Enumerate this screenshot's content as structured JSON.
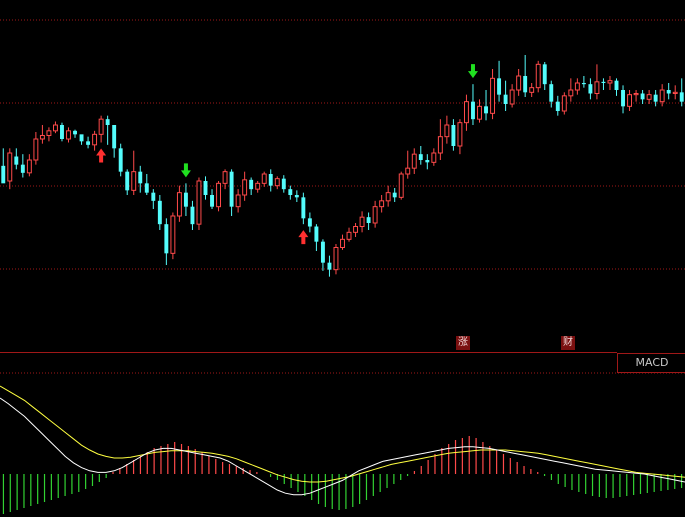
{
  "indicator_tab": {
    "label": "MACD"
  },
  "event_badges": [
    {
      "label": "涨"
    },
    {
      "label": "财"
    }
  ],
  "colors": {
    "up": "#ff4a4a",
    "down": "#54fcfc",
    "macd_positive": "#ff4a4a",
    "macd_negative": "#32d232",
    "dif_line": "#ffffff",
    "dea_line": "#ffff40",
    "grid": "#a01818",
    "buy_arrow": "#ff3030",
    "sell_arrow": "#20e020"
  },
  "chart_data": [
    {
      "type": "candlestick",
      "candles": [
        [
          175,
          160,
          165,
          190
        ],
        [
          162,
          186,
          155,
          190
        ],
        [
          183,
          176,
          172,
          190
        ],
        [
          176,
          169,
          165,
          185
        ],
        [
          169,
          180,
          166,
          185
        ],
        [
          180,
          198,
          176,
          204
        ],
        [
          198,
          201,
          194,
          210
        ],
        [
          201,
          205,
          196,
          208
        ],
        [
          205,
          210,
          203,
          213
        ],
        [
          210,
          198,
          196,
          212
        ],
        [
          198,
          205,
          195,
          208
        ],
        [
          205,
          202,
          199,
          206
        ],
        [
          202,
          196,
          193,
          198
        ],
        [
          196,
          193,
          190,
          200
        ],
        [
          193,
          202,
          188,
          205
        ],
        [
          202,
          215,
          195,
          218
        ],
        [
          215,
          210,
          193,
          218
        ],
        [
          210,
          190,
          182,
          200
        ],
        [
          190,
          170,
          166,
          194
        ],
        [
          170,
          154,
          150,
          172
        ],
        [
          154,
          170,
          150,
          188
        ],
        [
          170,
          160,
          152,
          175
        ],
        [
          160,
          152,
          150,
          168
        ],
        [
          152,
          145,
          138,
          155
        ],
        [
          145,
          125,
          120,
          150
        ],
        [
          125,
          100,
          90,
          130
        ],
        [
          100,
          132,
          95,
          135
        ],
        [
          132,
          152,
          127,
          158
        ],
        [
          152,
          140,
          132,
          160
        ],
        [
          140,
          125,
          120,
          145
        ],
        [
          125,
          162,
          120,
          165
        ],
        [
          162,
          150,
          146,
          166
        ],
        [
          150,
          140,
          138,
          155
        ],
        [
          140,
          160,
          136,
          162
        ],
        [
          160,
          170,
          155,
          172
        ],
        [
          170,
          140,
          132,
          172
        ],
        [
          140,
          150,
          135,
          155
        ],
        [
          150,
          163,
          145,
          170
        ],
        [
          163,
          155,
          150,
          165
        ],
        [
          155,
          160,
          152,
          162
        ],
        [
          160,
          168,
          157,
          170
        ],
        [
          168,
          158,
          153,
          172
        ],
        [
          158,
          164,
          155,
          166
        ],
        [
          164,
          155,
          152,
          167
        ],
        [
          155,
          150,
          146,
          158
        ],
        [
          150,
          148,
          144,
          154
        ],
        [
          148,
          130,
          125,
          152
        ],
        [
          130,
          123,
          118,
          135
        ],
        [
          123,
          110,
          102,
          125
        ],
        [
          110,
          92,
          85,
          112
        ],
        [
          92,
          86,
          80,
          98
        ],
        [
          86,
          105,
          82,
          108
        ],
        [
          105,
          112,
          103,
          116
        ],
        [
          112,
          118,
          110,
          122
        ],
        [
          118,
          123,
          114,
          126
        ],
        [
          123,
          131,
          118,
          136
        ],
        [
          131,
          126,
          120,
          135
        ],
        [
          126,
          140,
          122,
          145
        ],
        [
          140,
          145,
          135,
          150
        ],
        [
          145,
          152,
          140,
          158
        ],
        [
          152,
          148,
          144,
          156
        ],
        [
          148,
          168,
          146,
          170
        ],
        [
          168,
          173,
          164,
          188
        ],
        [
          173,
          185,
          168,
          190
        ],
        [
          185,
          180,
          176,
          192
        ],
        [
          180,
          178,
          172,
          185
        ],
        [
          178,
          186,
          175,
          190
        ],
        [
          186,
          200,
          180,
          215
        ],
        [
          200,
          210,
          194,
          218
        ],
        [
          210,
          192,
          188,
          215
        ],
        [
          192,
          212,
          185,
          215
        ],
        [
          212,
          230,
          205,
          236
        ],
        [
          230,
          215,
          210,
          245
        ],
        [
          215,
          226,
          212,
          232
        ],
        [
          226,
          220,
          214,
          240
        ],
        [
          220,
          250,
          215,
          258
        ],
        [
          250,
          236,
          230,
          265
        ],
        [
          236,
          228,
          222,
          248
        ],
        [
          228,
          240,
          225,
          245
        ],
        [
          240,
          252,
          235,
          258
        ],
        [
          252,
          238,
          234,
          270
        ],
        [
          238,
          242,
          234,
          246
        ],
        [
          242,
          262,
          238,
          265
        ],
        [
          262,
          245,
          240,
          264
        ],
        [
          245,
          230,
          225,
          248
        ],
        [
          230,
          222,
          218,
          235
        ],
        [
          222,
          235,
          219,
          238
        ],
        [
          235,
          240,
          230,
          250
        ],
        [
          240,
          246,
          236,
          250
        ],
        [
          246,
          245,
          242,
          252
        ],
        [
          245,
          237,
          232,
          250
        ],
        [
          237,
          247,
          232,
          262
        ],
        [
          247,
          246,
          240,
          250
        ],
        [
          246,
          248,
          240,
          252
        ],
        [
          248,
          240,
          235,
          250
        ],
        [
          240,
          226,
          220,
          244
        ],
        [
          226,
          236,
          222,
          240
        ],
        [
          236,
          237,
          230,
          240
        ],
        [
          237,
          232,
          228,
          240
        ],
        [
          232,
          236,
          228,
          240
        ],
        [
          236,
          230,
          226,
          240
        ],
        [
          230,
          240,
          226,
          245
        ],
        [
          240,
          237,
          232,
          246
        ],
        [
          237,
          238,
          232,
          244
        ],
        [
          238,
          230,
          226,
          250
        ]
      ],
      "signals": [
        {
          "type": "buy",
          "index": 15
        },
        {
          "type": "sell",
          "index": 28
        },
        {
          "type": "buy",
          "index": 46
        },
        {
          "type": "sell",
          "index": 72
        }
      ]
    },
    {
      "type": "macd",
      "histogram": [
        -40,
        -38,
        -36,
        -34,
        -32,
        -30,
        -28,
        -26,
        -24,
        -22,
        -20,
        -18,
        -15,
        -12,
        -8,
        -4,
        2,
        6,
        10,
        14,
        18,
        22,
        26,
        28,
        30,
        32,
        30,
        28,
        25,
        22,
        18,
        15,
        12,
        10,
        8,
        6,
        4,
        2,
        0,
        -3,
        -6,
        -10,
        -14,
        -18,
        -22,
        -26,
        -30,
        -33,
        -35,
        -36,
        -35,
        -33,
        -30,
        -26,
        -22,
        -18,
        -14,
        -10,
        -6,
        -2,
        3,
        8,
        14,
        20,
        26,
        30,
        34,
        36,
        38,
        36,
        32,
        28,
        24,
        20,
        16,
        12,
        8,
        5,
        2,
        -2,
        -6,
        -10,
        -13,
        -16,
        -18,
        -20,
        -22,
        -23,
        -24,
        -24,
        -23,
        -22,
        -21,
        -20,
        -19,
        -18,
        -17,
        -16,
        -15,
        -14
      ],
      "dif": [
        95,
        88,
        80,
        72,
        62,
        52,
        42,
        32,
        22,
        14,
        8,
        4,
        2,
        2,
        4,
        8,
        14,
        20,
        26,
        30,
        32,
        32,
        30,
        28,
        26,
        24,
        22,
        20,
        16,
        10,
        4,
        -2,
        -8,
        -14,
        -20,
        -24,
        -26,
        -26,
        -24,
        -20,
        -16,
        -12,
        -8,
        -2,
        4,
        8,
        12,
        16,
        18,
        20,
        22,
        24,
        26,
        28,
        30,
        32,
        33,
        34,
        34,
        33,
        32,
        30,
        28,
        26,
        24,
        22,
        20,
        18,
        16,
        14,
        12,
        10,
        8,
        6,
        5,
        4,
        3,
        2,
        1,
        0,
        -2,
        -4,
        -6,
        -8,
        -10
      ],
      "dea": [
        110,
        104,
        98,
        92,
        84,
        76,
        68,
        60,
        52,
        44,
        36,
        30,
        25,
        22,
        20,
        20,
        21,
        23,
        25,
        27,
        28,
        29,
        29,
        29,
        28,
        27,
        26,
        24,
        22,
        19,
        15,
        11,
        7,
        3,
        -1,
        -4,
        -7,
        -9,
        -10,
        -10,
        -9,
        -7,
        -5,
        -3,
        0,
        3,
        6,
        9,
        12,
        14,
        16,
        18,
        20,
        22,
        24,
        26,
        27,
        28,
        29,
        30,
        30,
        30,
        30,
        29,
        28,
        27,
        26,
        24,
        22,
        20,
        18,
        16,
        14,
        12,
        10,
        8,
        6,
        4,
        2,
        1,
        0,
        -1,
        -2,
        -3,
        -4
      ]
    }
  ]
}
